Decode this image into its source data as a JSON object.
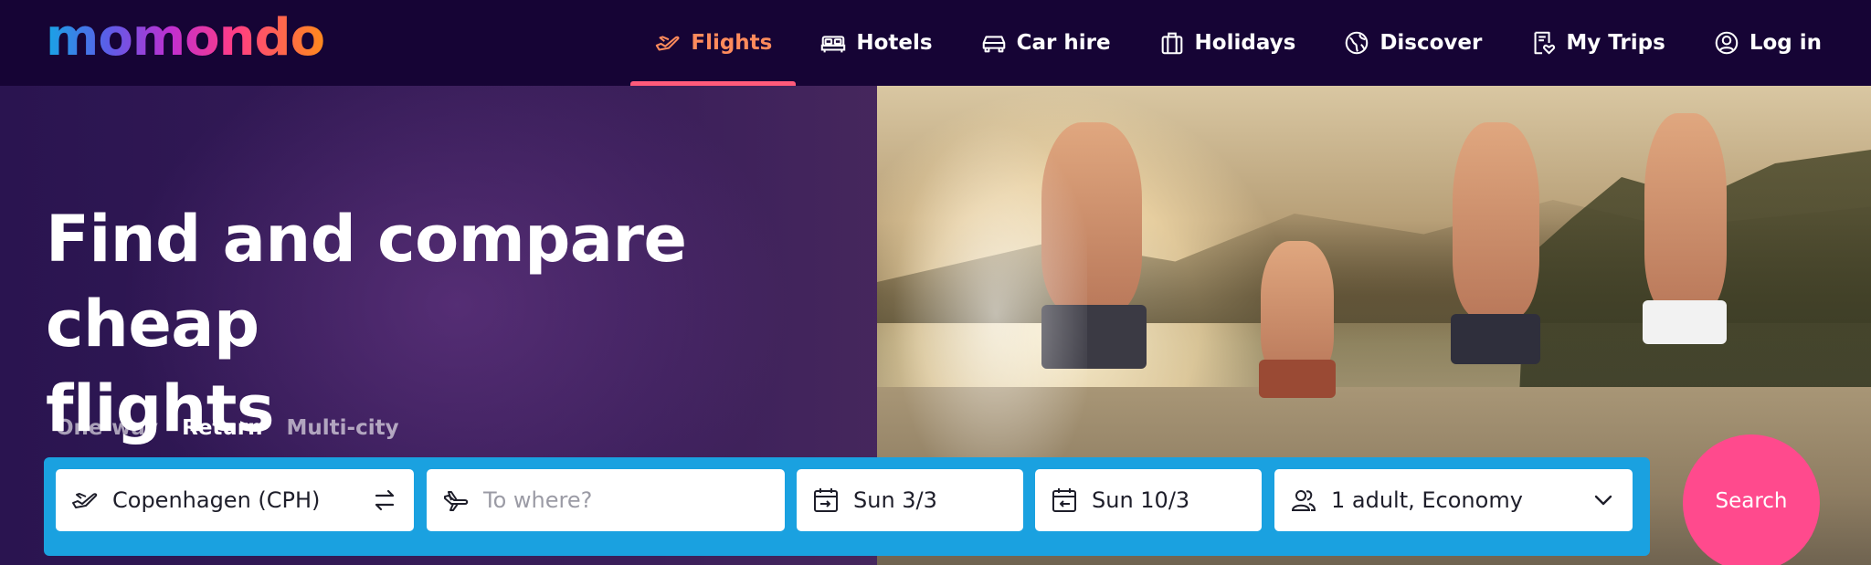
{
  "brand": {
    "logo_text": "momondo"
  },
  "nav": [
    {
      "label": "Flights",
      "icon": "plane-icon",
      "active": true
    },
    {
      "label": "Hotels",
      "icon": "bed-icon",
      "active": false
    },
    {
      "label": "Car hire",
      "icon": "car-icon",
      "active": false
    },
    {
      "label": "Holidays",
      "icon": "suitcase-icon",
      "active": false
    },
    {
      "label": "Discover",
      "icon": "globe-icon",
      "active": false
    },
    {
      "label": "My Trips",
      "icon": "trips-heart-icon",
      "active": false
    },
    {
      "label": "Log in",
      "icon": "user-icon",
      "active": false
    }
  ],
  "hero": {
    "headline_line1": "Find and compare cheap",
    "headline_line2": "flights"
  },
  "trip_types": [
    {
      "label": "One-way",
      "active": false
    },
    {
      "label": "Return",
      "active": true
    },
    {
      "label": "Multi-city",
      "active": false
    }
  ],
  "search": {
    "origin_value": "Copenhagen (CPH)",
    "destination_placeholder": "To where?",
    "depart_date": "Sun 3/3",
    "return_date": "Sun 10/3",
    "travellers": "1 adult, Economy",
    "button_label": "Search"
  },
  "colors": {
    "nav_bg": "#160435",
    "nav_active": "#ff8b5c",
    "nav_underline": "#ff5a7a",
    "search_panel": "#1aa1e0",
    "search_button": "#ff4a8d"
  }
}
